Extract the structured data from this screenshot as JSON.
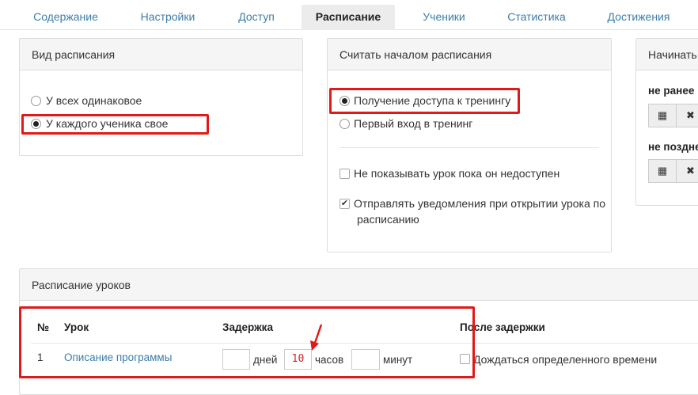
{
  "tabs": [
    {
      "label": "Содержание"
    },
    {
      "label": "Настройки"
    },
    {
      "label": "Доступ"
    },
    {
      "label": "Расписание",
      "active": true
    },
    {
      "label": "Ученики"
    },
    {
      "label": "Статистика"
    },
    {
      "label": "Достижения"
    }
  ],
  "schedule_type": {
    "title": "Вид расписания",
    "options": [
      {
        "label": "У всех одинаковое",
        "selected": false
      },
      {
        "label": "У каждого ученика свое",
        "selected": true
      }
    ]
  },
  "schedule_start": {
    "title": "Считать началом расписания",
    "options": [
      {
        "label": "Получение доступа к тренингу",
        "selected": true
      },
      {
        "label": "Первый вход в тренинг",
        "selected": false
      }
    ],
    "hide_lesson": {
      "label": "Не показывать урок пока он недоступен",
      "checked": false
    },
    "notify": {
      "label_line1": "Отправлять уведомления при открытии урока по",
      "label_line2": "расписанию",
      "checked": true
    }
  },
  "begin_panel": {
    "title": "Начинать",
    "not_earlier": "не ранее",
    "not_later": "не поздне"
  },
  "lessons": {
    "title": "Расписание уроков",
    "columns": {
      "num": "№",
      "lesson": "Урок",
      "delay": "Задержка",
      "after_delay": "После задержки"
    },
    "rows": [
      {
        "num": "1",
        "lesson": "Описание программы",
        "days_value": "",
        "days_label": "дней",
        "hours_value": "10",
        "hours_label": "часов",
        "minutes_value": "",
        "minutes_label": "минут",
        "wait_label": "Дождаться определенного времени"
      }
    ]
  },
  "colors": {
    "accent": "#3d7da8",
    "highlight": "#e01a1a",
    "panel_head": "#f5f5f5"
  }
}
